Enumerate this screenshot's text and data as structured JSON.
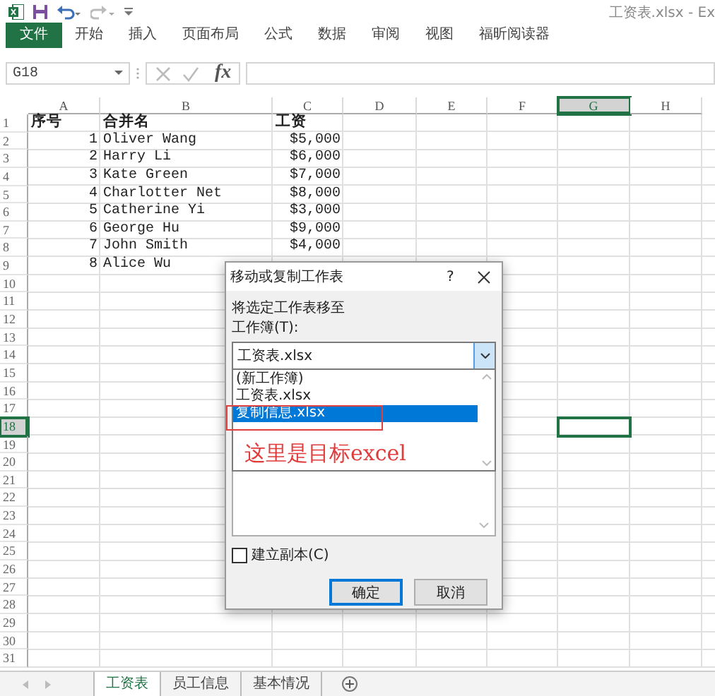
{
  "title_bar": {
    "title": "工资表.xlsx - Ex"
  },
  "ribbon_tabs": [
    {
      "label": "文件",
      "kind": "file"
    },
    {
      "label": "开始",
      "kind": "tab"
    },
    {
      "label": "插入",
      "kind": "tab"
    },
    {
      "label": "页面布局",
      "kind": "tab"
    },
    {
      "label": "公式",
      "kind": "tab"
    },
    {
      "label": "数据",
      "kind": "tab"
    },
    {
      "label": "审阅",
      "kind": "tab"
    },
    {
      "label": "视图",
      "kind": "tab"
    },
    {
      "label": "福昕阅读器",
      "kind": "tab"
    }
  ],
  "formula_bar": {
    "name_box": "G18",
    "function_symbol": "fx"
  },
  "columns": [
    {
      "label": "A",
      "selected": false
    },
    {
      "label": "B",
      "selected": false
    },
    {
      "label": "C",
      "selected": false
    },
    {
      "label": "D",
      "selected": false
    },
    {
      "label": "E",
      "selected": false
    },
    {
      "label": "F",
      "selected": false
    },
    {
      "label": "G",
      "selected": true
    },
    {
      "label": "H",
      "selected": false
    }
  ],
  "row_headers": [
    {
      "label": "1",
      "selected": false
    },
    {
      "label": "2",
      "selected": false
    },
    {
      "label": "3",
      "selected": false
    },
    {
      "label": "4",
      "selected": false
    },
    {
      "label": "5",
      "selected": false
    },
    {
      "label": "6",
      "selected": false
    },
    {
      "label": "7",
      "selected": false
    },
    {
      "label": "8",
      "selected": false
    },
    {
      "label": "9",
      "selected": false
    },
    {
      "label": "10",
      "selected": false
    },
    {
      "label": "11",
      "selected": false
    },
    {
      "label": "12",
      "selected": false
    },
    {
      "label": "13",
      "selected": false
    },
    {
      "label": "14",
      "selected": false
    },
    {
      "label": "15",
      "selected": false
    },
    {
      "label": "16",
      "selected": false
    },
    {
      "label": "17",
      "selected": false
    },
    {
      "label": "18",
      "selected": true
    },
    {
      "label": "19",
      "selected": false
    },
    {
      "label": "20",
      "selected": false
    },
    {
      "label": "21",
      "selected": false
    },
    {
      "label": "22",
      "selected": false
    },
    {
      "label": "23",
      "selected": false
    },
    {
      "label": "24",
      "selected": false
    },
    {
      "label": "25",
      "selected": false
    },
    {
      "label": "26",
      "selected": false
    },
    {
      "label": "27",
      "selected": false
    },
    {
      "label": "28",
      "selected": false
    },
    {
      "label": "29",
      "selected": false
    },
    {
      "label": "30",
      "selected": false
    },
    {
      "label": "31",
      "selected": false
    }
  ],
  "rows": [
    {
      "bold": true,
      "cells": [
        "序号",
        "合并名",
        "工资"
      ]
    },
    {
      "bold": false,
      "cells": [
        "1",
        "Oliver Wang",
        "$5,000"
      ]
    },
    {
      "bold": false,
      "cells": [
        "2",
        "Harry Li",
        "$6,000"
      ]
    },
    {
      "bold": false,
      "cells": [
        "3",
        "Kate Green",
        "$7,000"
      ]
    },
    {
      "bold": false,
      "cells": [
        "4",
        "Charlotter Net",
        "$8,000"
      ]
    },
    {
      "bold": false,
      "cells": [
        "5",
        "Catherine Yi",
        "$3,000"
      ]
    },
    {
      "bold": false,
      "cells": [
        "6",
        "George Hu",
        "$9,000"
      ]
    },
    {
      "bold": false,
      "cells": [
        "7",
        "John Smith",
        "$4,000"
      ]
    },
    {
      "bold": false,
      "cells": [
        "8",
        "Alice Wu",
        ""
      ]
    }
  ],
  "dialog": {
    "title": "移动或复制工作表",
    "help": "?",
    "prompt": "将选定工作表移至",
    "workbook_label": "工作簿(T):",
    "workbook_value": "工资表.xlsx",
    "options": [
      {
        "label": "(新工作簿)",
        "selected": false
      },
      {
        "label": "工资表.xlsx",
        "selected": false
      },
      {
        "label": "复制信息.xlsx",
        "selected": true
      }
    ],
    "copy_checkbox": {
      "label": "建立副本(C)",
      "checked": false
    },
    "buttons": [
      {
        "label": "确定",
        "focused": true
      },
      {
        "label": "取消",
        "focused": false
      }
    ]
  },
  "annotation": {
    "text": "这里是目标excel"
  },
  "sheet_tabs": [
    {
      "label": "工资表",
      "selected": true
    },
    {
      "label": "员工信息",
      "selected": false
    },
    {
      "label": "基本情况",
      "selected": false
    }
  ]
}
